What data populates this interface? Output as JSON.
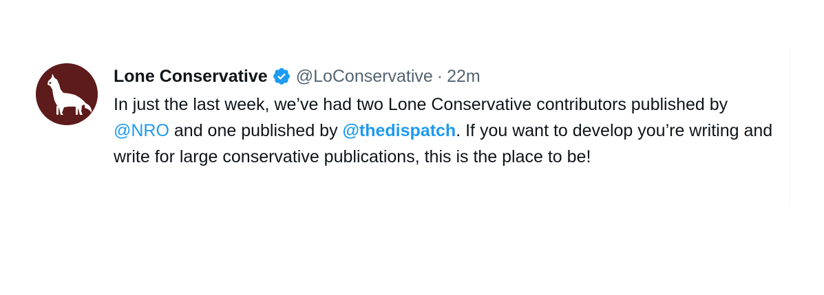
{
  "tweet": {
    "author": {
      "display_name": "Lone Conservative",
      "handle": "@LoConservative",
      "verified": true,
      "avatar_icon": "howling-coyote-icon",
      "avatar_color": "#5e1b1b"
    },
    "separator": "·",
    "timestamp": "22m",
    "more_icon": "ellipsis-icon",
    "text": {
      "part1": "In just the last week, we’ve had two Lone Conservative contributors published by ",
      "mention1": "@NRO",
      "part2": " and one published by ",
      "mention2": "@thedispatch",
      "part3": ". If you want to develop you’re writing and write for large conservative publications, this is the place to be!"
    }
  },
  "colors": {
    "text": "#0f1419",
    "secondary": "#536471",
    "link": "#1d9bf0",
    "verified_badge": "#1d9bf0"
  }
}
